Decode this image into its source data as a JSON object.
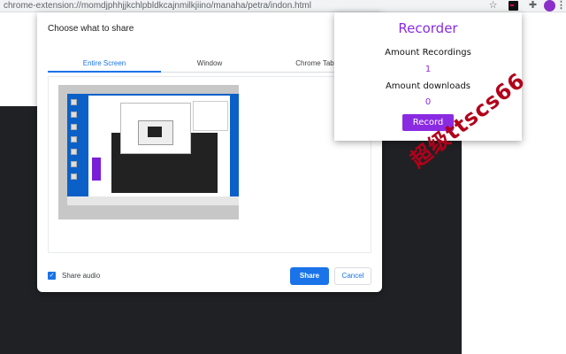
{
  "browser": {
    "url": "chrome-extension://momdjphhjjkchlpbldkcajnmilkjiino/manaha/petra/indon.html"
  },
  "share_dialog": {
    "title": "Choose what to share",
    "tabs": [
      {
        "label": "Entire Screen",
        "active": true
      },
      {
        "label": "Window",
        "active": false
      },
      {
        "label": "Chrome Tab",
        "active": false
      }
    ],
    "share_audio_label": "Share audio",
    "share_audio_checked": true,
    "share_button": "Share",
    "cancel_button": "Cancel"
  },
  "recorder": {
    "title": "Recorder",
    "amount_recordings_label": "Amount Recordings",
    "amount_recordings_value": "1",
    "amount_downloads_label": "Amount downloads",
    "amount_downloads_value": "0",
    "record_button": "Record"
  },
  "watermark": "超级ttscs66",
  "colors": {
    "accent_purple": "#8a2be2",
    "accent_blue": "#1a73e8",
    "watermark_red": "#b2001a",
    "dark_background": "#202124"
  }
}
